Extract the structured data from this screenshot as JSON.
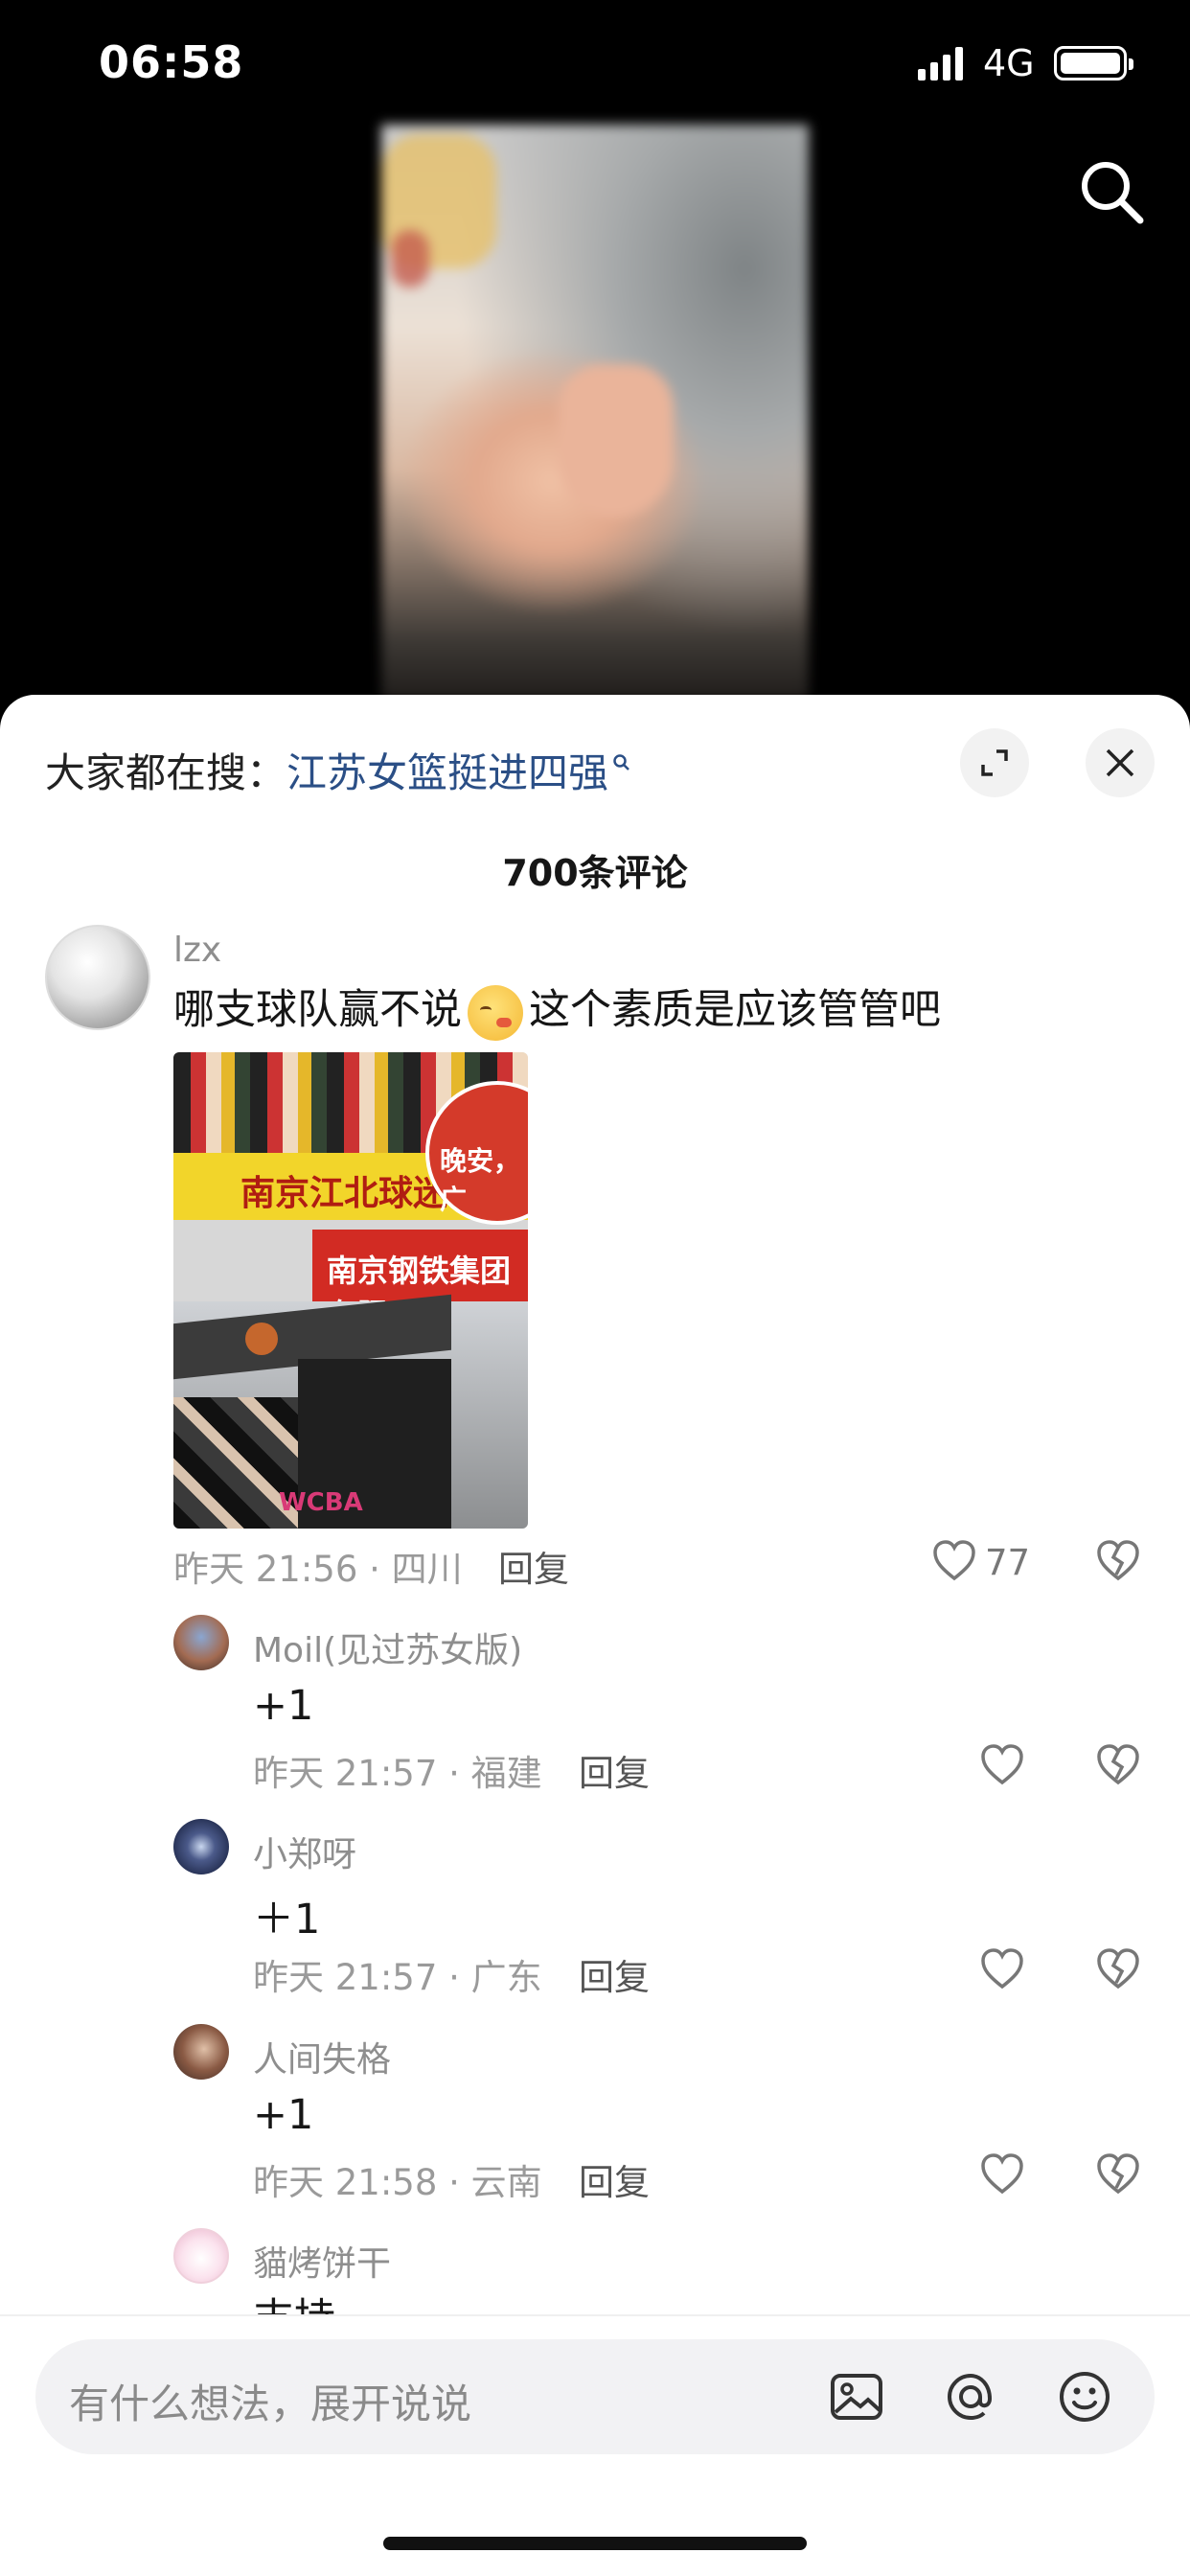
{
  "status_bar": {
    "time": "06:58",
    "network": "4G"
  },
  "sheet": {
    "trending_prefix": "大家都在搜：",
    "trending_query": "江苏女篮挺进四强",
    "comment_count": "700条评论"
  },
  "comments": [
    {
      "user": "lzx",
      "text_before": "哪支球队赢不说",
      "text_after": "这个素质是应该管管吧",
      "meta": "昨天 21:56 · 四川",
      "reply": "回复",
      "likes": "77",
      "photo": {
        "banner1": "南京江北球迷联",
        "circle": "晚安，广",
        "banner2": "南京钢铁集团有限",
        "logo": "WCBA"
      }
    }
  ],
  "replies": [
    {
      "user": "Moil(见过苏女版)",
      "text": "+1",
      "meta": "昨天 21:57 · 福建",
      "reply": "回复"
    },
    {
      "user": "小郑呀",
      "text": "＋1",
      "meta": "昨天 21:57 · 广东",
      "reply": "回复"
    },
    {
      "user": "人间失格",
      "text": "+1",
      "meta": "昨天 21:58 · 云南",
      "reply": "回复"
    },
    {
      "user": "貓烤饼干",
      "text": "支持"
    }
  ],
  "input": {
    "placeholder": "有什么想法，展开说说"
  },
  "icons": [
    "signal-icon",
    "battery-icon",
    "search-icon",
    "expand-icon",
    "close-icon",
    "heart-icon",
    "broken-heart-icon",
    "image-icon",
    "at-icon",
    "emoji-icon"
  ]
}
